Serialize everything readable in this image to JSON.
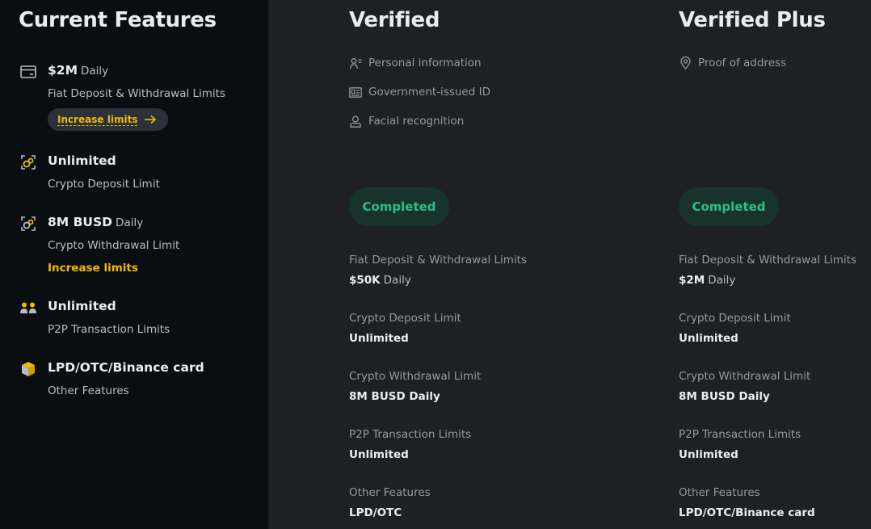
{
  "current": {
    "title": "Current Features",
    "items": [
      {
        "icon": "card-icon",
        "value": "$2M",
        "unit": "Daily",
        "label": "Fiat Deposit & Withdrawal Limits",
        "action": "Increase limits"
      },
      {
        "icon": "crypto-deposit-icon",
        "value": "Unlimited",
        "unit": "",
        "label": "Crypto Deposit Limit"
      },
      {
        "icon": "crypto-withdrawal-icon",
        "value": "8M BUSD",
        "unit": "Daily",
        "label": "Crypto Withdrawal Limit",
        "action": "Increase limits"
      },
      {
        "icon": "p2p-users-icon",
        "value": "Unlimited",
        "unit": "",
        "label": "P2P Transaction Limits"
      },
      {
        "icon": "cube-icon",
        "value": "LPD/OTC/Binance card",
        "unit": "",
        "label": "Other Features"
      }
    ]
  },
  "verified": {
    "title": "Verified",
    "requirements": [
      "Personal information",
      "Government-issued ID",
      "Facial recognition"
    ],
    "status": "Completed",
    "limits": [
      {
        "name": "Fiat Deposit & Withdrawal Limits",
        "value": "$50K",
        "unit": "Daily"
      },
      {
        "name": "Crypto Deposit Limit",
        "value": "Unlimited",
        "unit": ""
      },
      {
        "name": "Crypto Withdrawal Limit",
        "value": "8M BUSD Daily",
        "unit": ""
      },
      {
        "name": "P2P Transaction Limits",
        "value": "Unlimited",
        "unit": ""
      },
      {
        "name": "Other Features",
        "value": "LPD/OTC",
        "unit": ""
      }
    ]
  },
  "verified_plus": {
    "title": "Verified Plus",
    "requirements": [
      "Proof of address"
    ],
    "status": "Completed",
    "limits": [
      {
        "name": "Fiat Deposit & Withdrawal Limits",
        "value": "$2M",
        "unit": "Daily"
      },
      {
        "name": "Crypto Deposit Limit",
        "value": "Unlimited",
        "unit": ""
      },
      {
        "name": "Crypto Withdrawal Limit",
        "value": "8M BUSD Daily",
        "unit": ""
      },
      {
        "name": "P2P Transaction Limits",
        "value": "Unlimited",
        "unit": ""
      },
      {
        "name": "Other Features",
        "value": "LPD/OTC/Binance card",
        "unit": ""
      }
    ]
  },
  "colors": {
    "accent": "#f0b90b",
    "success": "#2ebd85",
    "bg": "#1e2026",
    "panel": "#0b0e11"
  }
}
